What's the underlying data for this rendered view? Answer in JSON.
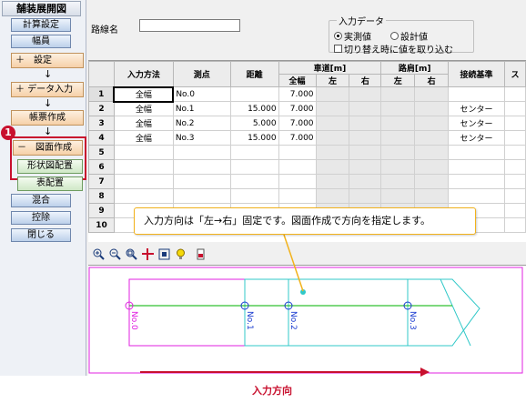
{
  "sidebar": {
    "title": "舗装展開図",
    "collapse_glyph": "<<",
    "items": [
      {
        "label": "計算設定"
      },
      {
        "label": "幅員"
      },
      {
        "label": "＋　設定"
      },
      {
        "label": "＋ データ入力"
      },
      {
        "label": "帳票作成"
      },
      {
        "label": "－　図面作成"
      },
      {
        "label": "形状図配置"
      },
      {
        "label": "表配置"
      },
      {
        "label": "混合"
      },
      {
        "label": "控除"
      },
      {
        "label": "閉じる"
      }
    ],
    "arrow": "↓",
    "badge": "1"
  },
  "header": {
    "route_label": "路線名",
    "route_value": "",
    "input_data_legend": "入力データ",
    "radio_measured": "実測値",
    "radio_design": "設計値",
    "radio_selected": "実測値",
    "checkbox_label": "切り替え時に値を取り込む",
    "checkbox_checked": false
  },
  "grid": {
    "headers": {
      "input_method": "入力方法",
      "point": "測点",
      "distance": "距離",
      "roadway": "車道[m]",
      "shoulder": "路肩[m]",
      "connection": "接続基準",
      "extra": "ス",
      "all_width": "全幅",
      "left": "左",
      "right": "右"
    },
    "rows": [
      {
        "no": "1",
        "method": "全幅",
        "point": "No.0",
        "distance": "",
        "all": "7.000",
        "left": "",
        "right": "",
        "sleft": "",
        "sright": "",
        "conn": ""
      },
      {
        "no": "2",
        "method": "全幅",
        "point": "No.1",
        "distance": "15.000",
        "all": "7.000",
        "left": "",
        "right": "",
        "sleft": "",
        "sright": "",
        "conn": "センター"
      },
      {
        "no": "3",
        "method": "全幅",
        "point": "No.2",
        "distance": "5.000",
        "all": "7.000",
        "left": "",
        "right": "",
        "sleft": "",
        "sright": "",
        "conn": "センター"
      },
      {
        "no": "4",
        "method": "全幅",
        "point": "No.3",
        "distance": "15.000",
        "all": "7.000",
        "left": "",
        "right": "",
        "sleft": "",
        "sright": "",
        "conn": "センター"
      },
      {
        "no": "5",
        "method": "",
        "point": "",
        "distance": "",
        "all": "",
        "left": "",
        "right": "",
        "sleft": "",
        "sright": "",
        "conn": ""
      },
      {
        "no": "6",
        "method": "",
        "point": "",
        "distance": "",
        "all": "",
        "left": "",
        "right": "",
        "sleft": "",
        "sright": "",
        "conn": ""
      },
      {
        "no": "7",
        "method": "",
        "point": "",
        "distance": "",
        "all": "",
        "left": "",
        "right": "",
        "sleft": "",
        "sright": "",
        "conn": ""
      },
      {
        "no": "8",
        "method": "",
        "point": "",
        "distance": "",
        "all": "",
        "left": "",
        "right": "",
        "sleft": "",
        "sright": "",
        "conn": ""
      },
      {
        "no": "9",
        "method": "",
        "point": "",
        "distance": "",
        "all": "",
        "left": "",
        "right": "",
        "sleft": "",
        "sright": "",
        "conn": ""
      },
      {
        "no": "10",
        "method": "",
        "point": "",
        "distance": "",
        "all": "",
        "left": "",
        "right": "",
        "sleft": "",
        "sright": "",
        "conn": ""
      }
    ]
  },
  "toolbar": {
    "icons": [
      "zoom-in-icon",
      "zoom-out-icon",
      "zoom-fit-icon",
      "pan-icon",
      "zoom-window-icon",
      "light-bulb-icon",
      "print-icon"
    ]
  },
  "drawing": {
    "station_labels": [
      "No.0",
      "No.1",
      "No.2",
      "No.3"
    ]
  },
  "callout": {
    "text": "入力方向は「左→右」固定です。図面作成で方向を指定します。"
  },
  "footer": {
    "direction_label": "入力方向"
  },
  "colors": {
    "accent_red": "#c8102e",
    "callout_border": "#f2b21b",
    "drawing_magenta": "#e020e0",
    "drawing_cyan": "#30c8c8",
    "drawing_green": "#30c030",
    "drawing_blue": "#1a3bd0"
  }
}
